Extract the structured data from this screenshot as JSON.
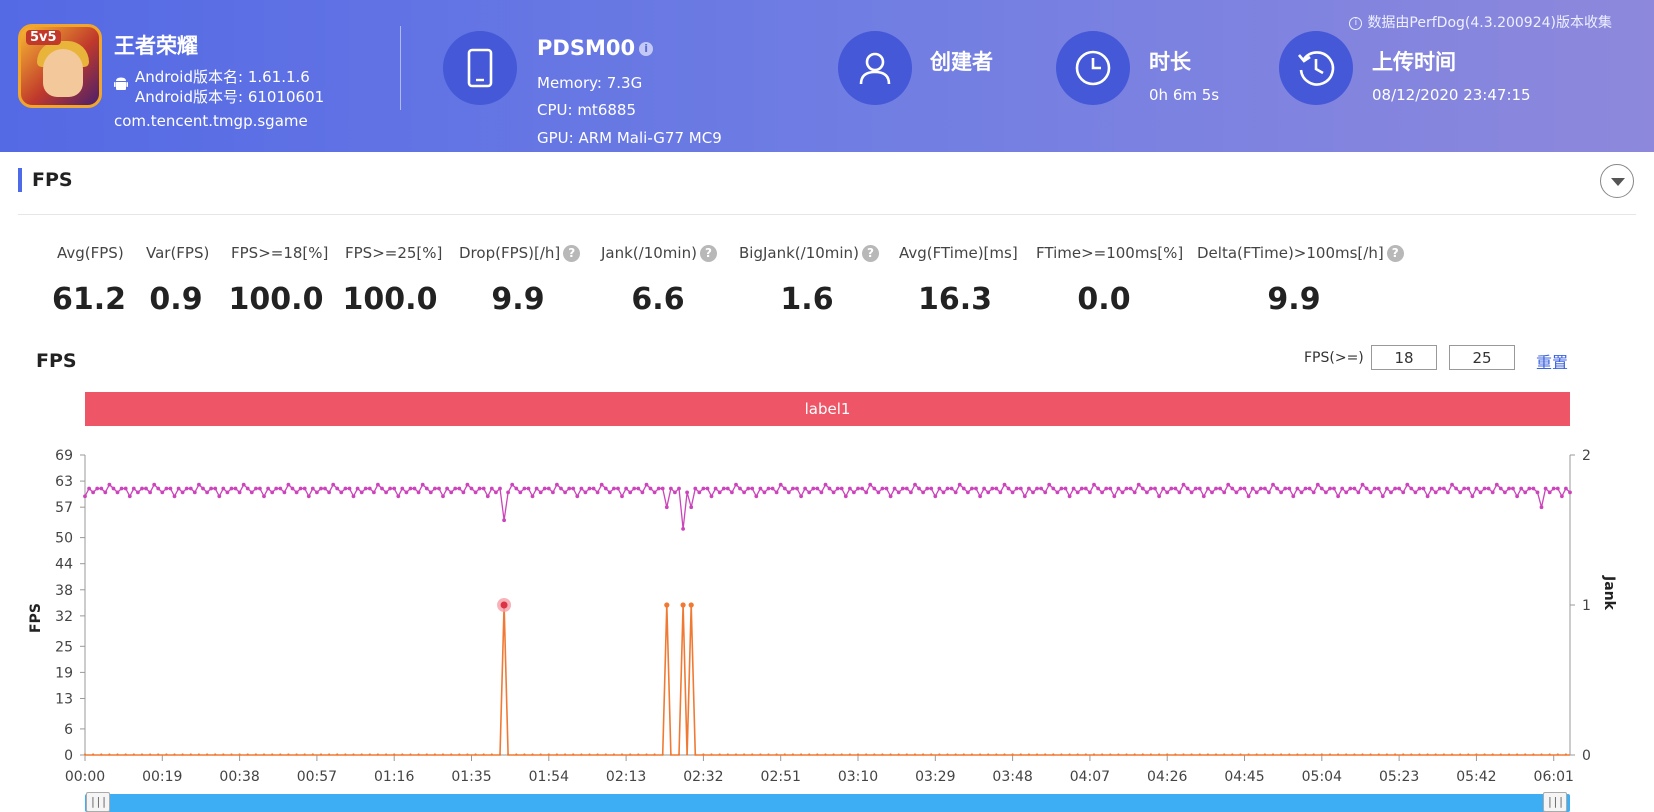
{
  "header": {
    "app_name": "王者荣耀",
    "app_badge": "5v5",
    "android_version_name": "Android版本名: 1.61.1.6",
    "android_version_code": "Android版本号: 61010601",
    "package": "com.tencent.tmgp.sgame",
    "device_name": "PDSM00",
    "memory": "Memory: 7.3G",
    "cpu": "CPU: mt6885",
    "gpu": "GPU: ARM Mali-G77 MC9",
    "creator_label": "创建者",
    "duration_label": "时长",
    "duration_value": "0h 6m 5s",
    "upload_label": "上传时间",
    "upload_value": "08/12/2020 23:47:15",
    "notice": "数据由PerfDog(4.3.200924)版本收集"
  },
  "section": {
    "title": "FPS"
  },
  "stats": [
    {
      "label": "Avg(FPS)",
      "value": "61.2",
      "help": false
    },
    {
      "label": "Var(FPS)",
      "value": "0.9",
      "help": false
    },
    {
      "label": "FPS>=18[%]",
      "value": "100.0",
      "help": false
    },
    {
      "label": "FPS>=25[%]",
      "value": "100.0",
      "help": false
    },
    {
      "label": "Drop(FPS)[/h]",
      "value": "9.9",
      "help": true
    },
    {
      "label": "Jank(/10min)",
      "value": "6.6",
      "help": true
    },
    {
      "label": "BigJank(/10min)",
      "value": "1.6",
      "help": true
    },
    {
      "label": "Avg(FTime)[ms]",
      "value": "16.3",
      "help": false
    },
    {
      "label": "FTime>=100ms[%]",
      "value": "0.0",
      "help": false
    },
    {
      "label": "Delta(FTime)>100ms[/h]",
      "value": "9.9",
      "help": true
    }
  ],
  "chart_controls": {
    "title": "FPS",
    "threshold_label": "FPS(>=)",
    "threshold_1": "18",
    "threshold_2": "25",
    "reset_label": "重置",
    "band_label": "label1"
  },
  "colors": {
    "fps_series": "#cc44bb",
    "jank_series": "#f07a33",
    "band": "#ee5566",
    "accent": "#4d6ae8"
  },
  "chart_data": {
    "type": "line",
    "ylabel": "FPS",
    "y2label": "Jank",
    "ylim": [
      0,
      69
    ],
    "y2lim": [
      0,
      2
    ],
    "y_ticks": [
      "0",
      "6",
      "13",
      "19",
      "25",
      "32",
      "38",
      "44",
      "50",
      "57",
      "63",
      "69"
    ],
    "y2_ticks": [
      "0",
      "1",
      "2"
    ],
    "x_ticks": [
      "00:00",
      "00:19",
      "00:38",
      "00:57",
      "01:16",
      "01:35",
      "01:54",
      "02:13",
      "02:32",
      "02:51",
      "03:10",
      "03:29",
      "03:48",
      "04:07",
      "04:26",
      "04:45",
      "05:04",
      "05:23",
      "05:42",
      "06:01"
    ],
    "series": [
      {
        "name": "FPS",
        "x_range_seconds": [
          0,
          365
        ],
        "baseline": 61,
        "dips": [
          [
            103,
            54
          ],
          [
            143,
            57
          ],
          [
            147,
            52
          ],
          [
            149,
            57
          ],
          [
            358,
            57
          ]
        ]
      },
      {
        "name": "Jank",
        "events_seconds": [
          103,
          143,
          147,
          149
        ],
        "event_value": 1
      }
    ]
  }
}
